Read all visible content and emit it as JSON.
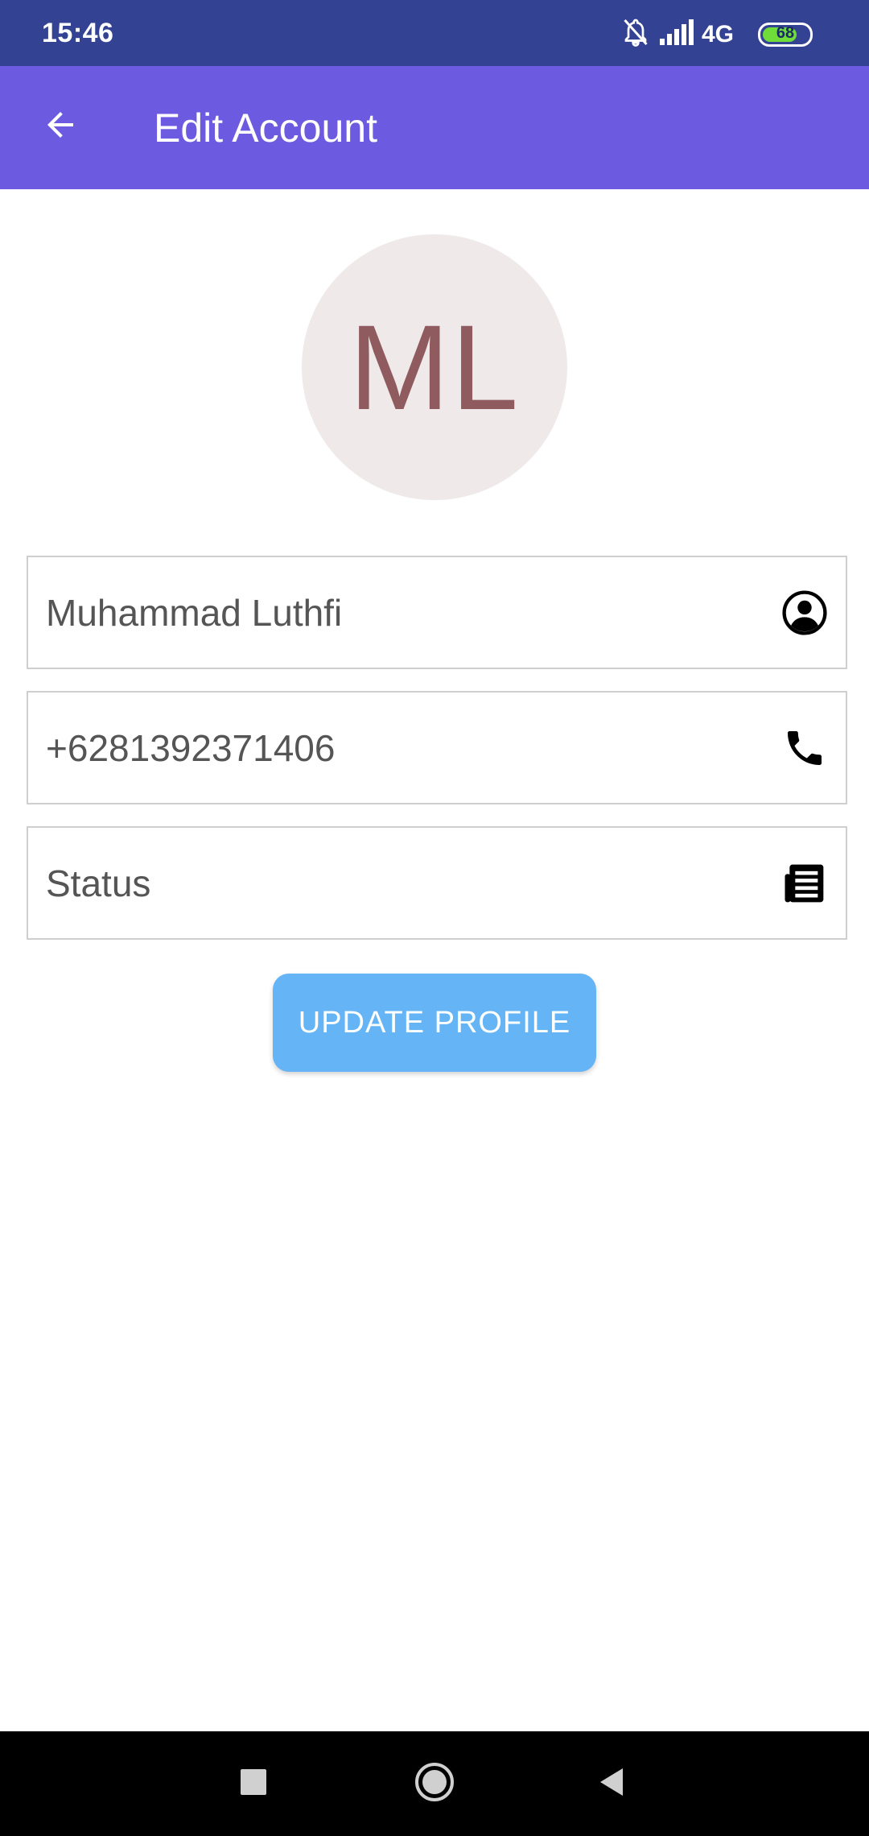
{
  "status_bar": {
    "time": "15:46",
    "network": "4G",
    "battery_level": "68",
    "icons": [
      "notifications-off-icon",
      "signal-icon",
      "battery-icon"
    ]
  },
  "app_bar": {
    "title": "Edit Account",
    "back_icon": "arrow-back-icon"
  },
  "avatar": {
    "initials": "ML"
  },
  "fields": {
    "name": {
      "value": "Muhammad Luthfi",
      "icon": "account-circle-icon"
    },
    "phone": {
      "value": "+6281392371406",
      "icon": "phone-icon"
    },
    "status": {
      "value": "",
      "placeholder": "Status",
      "icon": "article-icon"
    }
  },
  "update_button": {
    "label": "UPDATE PROFILE"
  },
  "nav_bar": {
    "buttons": [
      "recents-square-icon",
      "home-circle-icon",
      "back-triangle-icon"
    ]
  },
  "colors": {
    "status_bar": "#334293",
    "app_bar": "#6c5ae0",
    "avatar_bg": "#efe9ea",
    "avatar_text": "#8f5b5e",
    "button": "#64b4f6"
  }
}
